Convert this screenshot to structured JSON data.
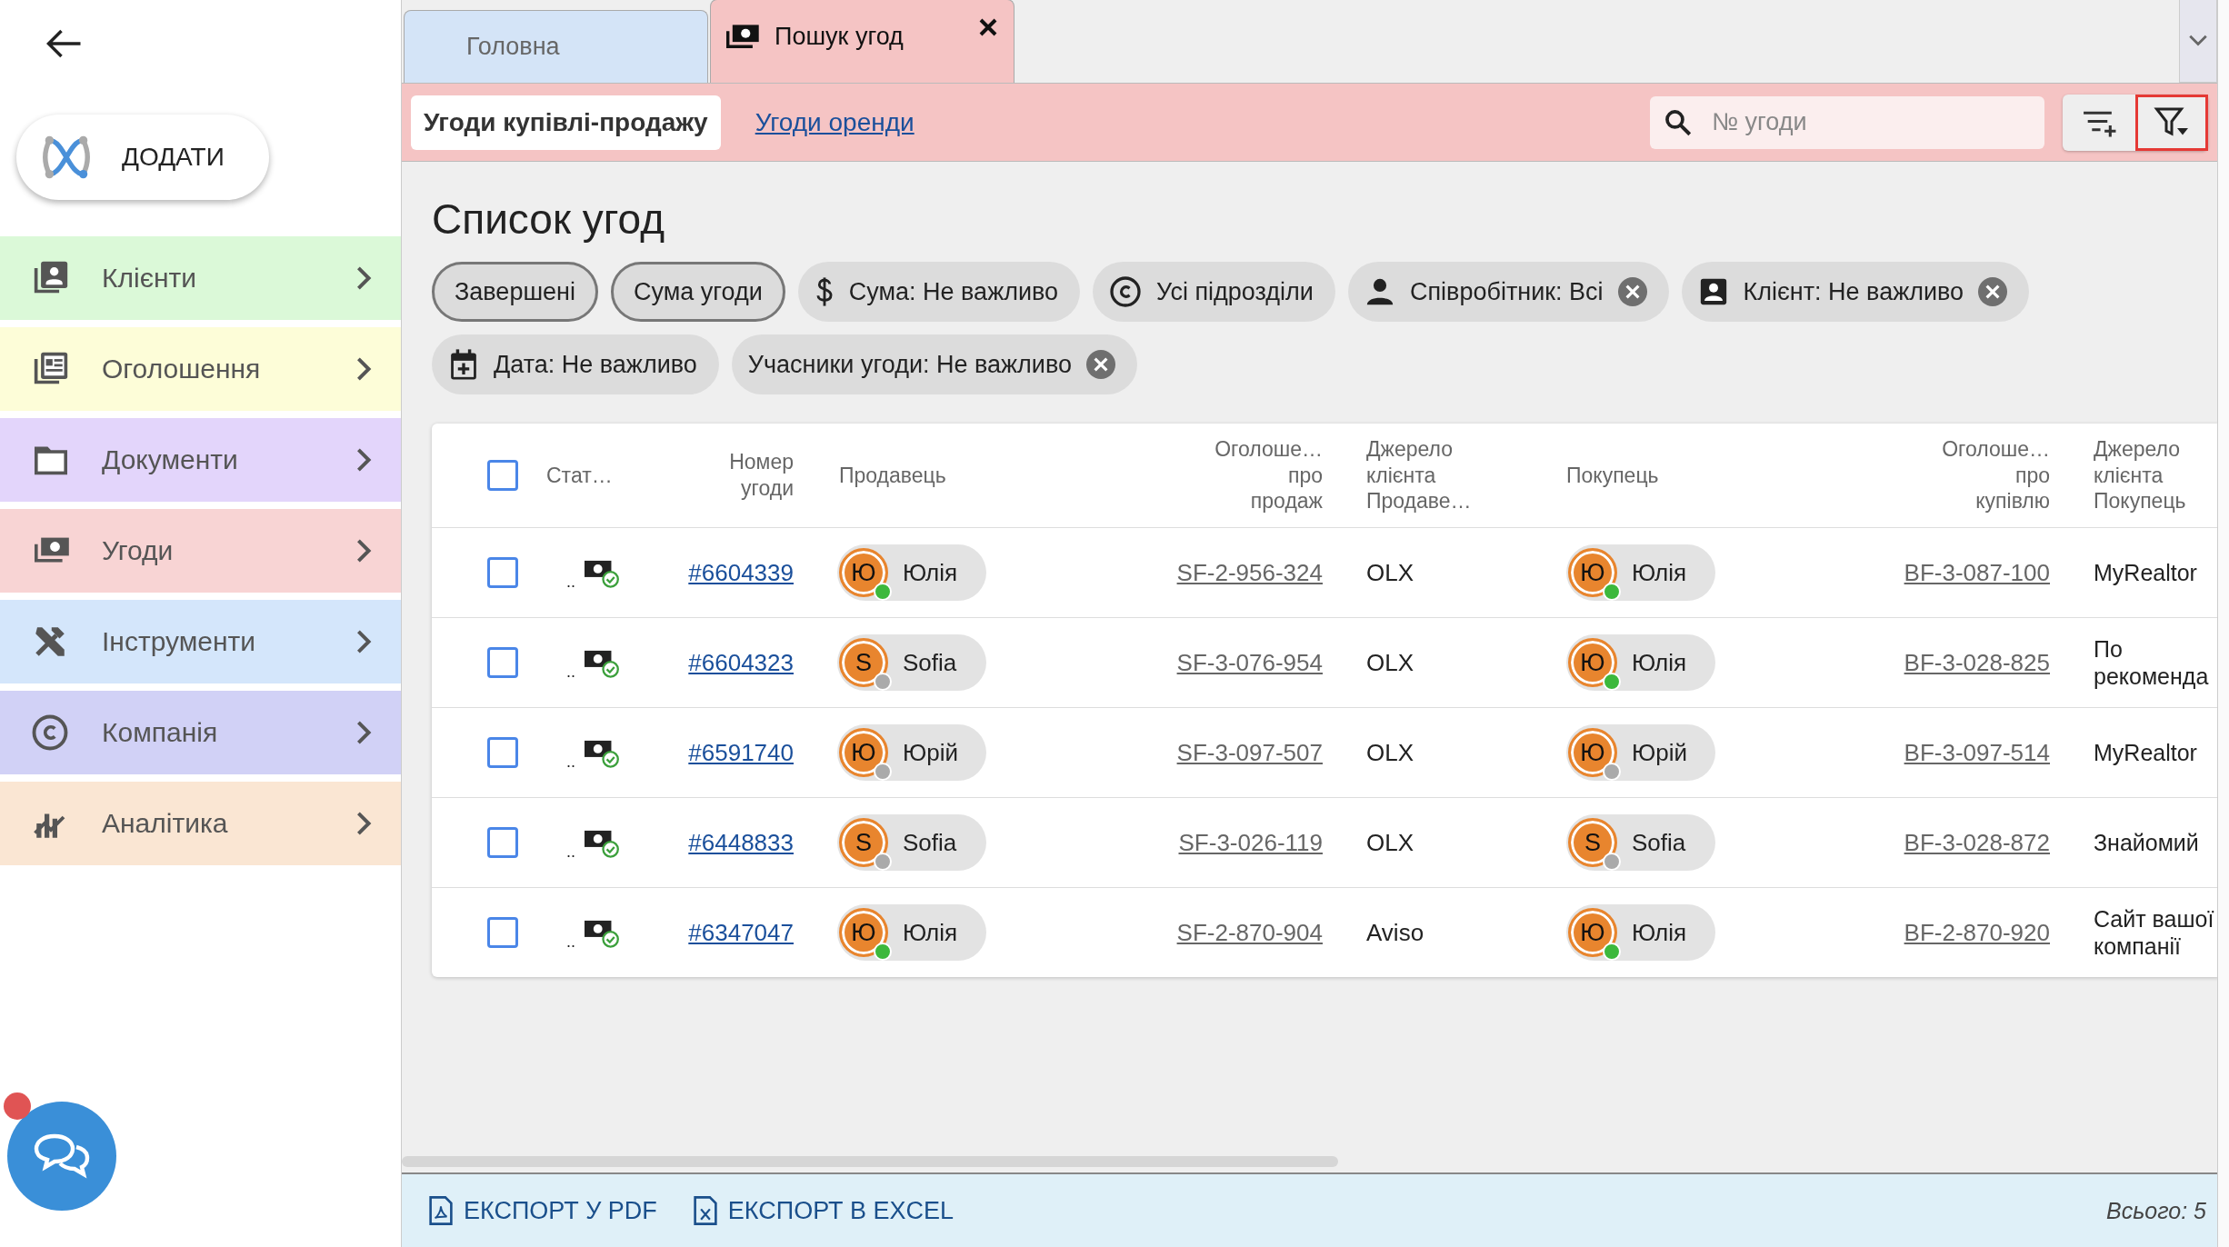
{
  "sidebar": {
    "add_button": {
      "label": "ДОДАТИ"
    },
    "items": [
      {
        "kind": "clients",
        "label": "Клієнти",
        "color": "#dbf9d8"
      },
      {
        "kind": "listings",
        "label": "Оголошення",
        "color": "#fdfdd8"
      },
      {
        "kind": "documents",
        "label": "Документи",
        "color": "#e3d5fb"
      },
      {
        "kind": "deals",
        "label": "Угоди",
        "color": "#f8d4d4"
      },
      {
        "kind": "tools",
        "label": "Інструменти",
        "color": "#d4e6fb"
      },
      {
        "kind": "company",
        "label": "Компанія",
        "color": "#d1d1f6"
      },
      {
        "kind": "analytics",
        "label": "Аналітика",
        "color": "#fae6d3"
      }
    ],
    "chat": {
      "notification": true
    }
  },
  "tabs": [
    {
      "label": "Головна",
      "selected": false,
      "closable": false,
      "kind": "plain"
    },
    {
      "label": "Пошук угод",
      "selected": true,
      "closable": true,
      "kind": "deals"
    }
  ],
  "toolbar": {
    "subtabs": [
      {
        "label": "Угоди купівлі-продажу",
        "selected": true
      },
      {
        "label": "Угоди оренди",
        "selected": false
      }
    ],
    "search": {
      "placeholder": "№ угоди"
    },
    "filter_active": true
  },
  "title": "Список угод",
  "chips": [
    {
      "kind": "outlined",
      "label": "Завершені",
      "removable": false
    },
    {
      "kind": "outlined",
      "label": "Сума угоди",
      "removable": false
    },
    {
      "kind": "amount",
      "label": "Сума: Не важливо",
      "removable": false
    },
    {
      "kind": "department",
      "label": "Усі підрозділи",
      "removable": false
    },
    {
      "kind": "employee",
      "label": "Співробітник: Всі",
      "removable": true
    },
    {
      "kind": "client",
      "label": "Клієнт: Не важливо",
      "removable": true
    },
    {
      "kind": "date",
      "label": "Дата: Не важливо",
      "removable": false
    },
    {
      "kind": "plain",
      "label": "Учасники угоди: Не важливо",
      "removable": true
    }
  ],
  "table": {
    "all_checked": false,
    "columns": [
      "Стат…",
      "Номер\nугоди",
      "Продавець",
      "Оголоше…\nпро\nпродаж",
      "Джерело\nклієнта\nПродаве…",
      "Покупець",
      "Оголоше…\nпро\nкупівлю",
      "Джерело\nклієнта\nПокупець"
    ],
    "rows": [
      {
        "checked": false,
        "status": "..",
        "number": "#6604339",
        "seller": {
          "initial": "Ю",
          "name": "Юлія",
          "online": true
        },
        "ad_sale": "SF-2-956-324",
        "source_seller": "OLX",
        "buyer": {
          "initial": "Ю",
          "name": "Юлія",
          "online": true
        },
        "ad_buy": "BF-3-087-100",
        "source_buyer": "MyRealtor"
      },
      {
        "checked": false,
        "status": "..",
        "number": "#6604323",
        "seller": {
          "initial": "S",
          "name": "Sofia",
          "online": false
        },
        "ad_sale": "SF-3-076-954",
        "source_seller": "OLX",
        "buyer": {
          "initial": "Ю",
          "name": "Юлія",
          "online": true
        },
        "ad_buy": "BF-3-028-825",
        "source_buyer": "По рекоменда"
      },
      {
        "checked": false,
        "status": "..",
        "number": "#6591740",
        "seller": {
          "initial": "Ю",
          "name": "Юрій",
          "online": false
        },
        "ad_sale": "SF-3-097-507",
        "source_seller": "OLX",
        "buyer": {
          "initial": "Ю",
          "name": "Юрій",
          "online": false
        },
        "ad_buy": "BF-3-097-514",
        "source_buyer": "MyRealtor"
      },
      {
        "checked": false,
        "status": "..",
        "number": "#6448833",
        "seller": {
          "initial": "S",
          "name": "Sofia",
          "online": false
        },
        "ad_sale": "SF-3-026-119",
        "source_seller": "OLX",
        "buyer": {
          "initial": "S",
          "name": "Sofia",
          "online": false
        },
        "ad_buy": "BF-3-028-872",
        "source_buyer": "Знайомий"
      },
      {
        "checked": false,
        "status": "..",
        "number": "#6347047",
        "seller": {
          "initial": "Ю",
          "name": "Юлія",
          "online": true
        },
        "ad_sale": "SF-2-870-904",
        "source_seller": "Aviso",
        "buyer": {
          "initial": "Ю",
          "name": "Юлія",
          "online": true
        },
        "ad_buy": "BF-2-870-920",
        "source_buyer": "Сайт вашої компанії"
      }
    ]
  },
  "footer": {
    "exports": [
      {
        "kind": "pdf",
        "label": "ЕКСПОРТ У PDF"
      },
      {
        "kind": "excel",
        "label": "ЕКСПОРТ В EXCEL"
      }
    ],
    "total": "Всього: 5"
  }
}
